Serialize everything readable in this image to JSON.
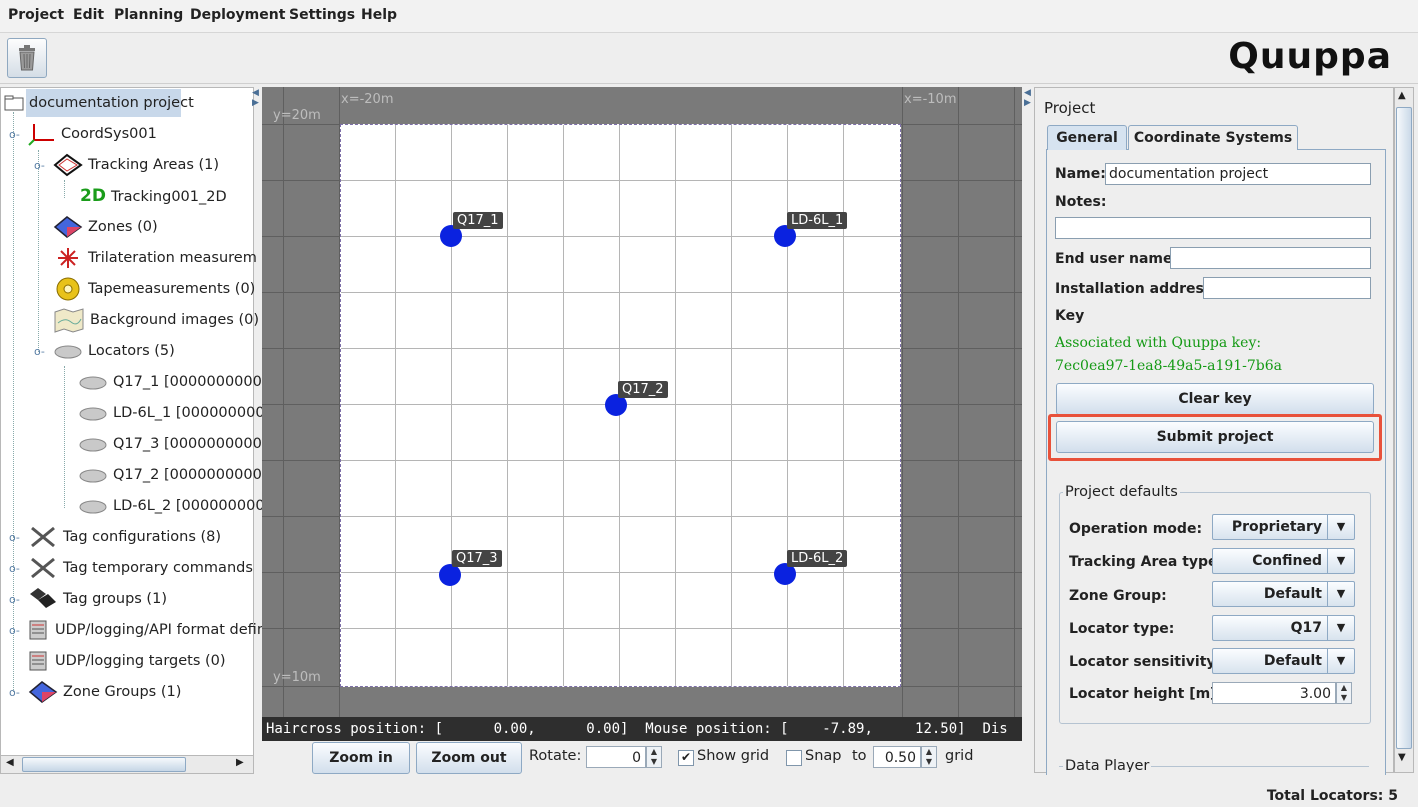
{
  "menubar": {
    "items": [
      "Project",
      "Edit",
      "Planning",
      "Deployment",
      "Settings",
      "Help"
    ]
  },
  "toolbar": {
    "trash_icon": "trash-icon",
    "logo_text": "Quuppa"
  },
  "tree": {
    "root": "documentation project",
    "coordsys": "CoordSys001",
    "tracking_areas": "Tracking Areas (1)",
    "tracking_2d_prefix": "2D",
    "tracking_item": "Tracking001_2D",
    "zones": "Zones (0)",
    "trilateration": "Trilateration measurem",
    "tapemeasurements": "Tapemeasurements (0)",
    "background_images": "Background images (0)",
    "locators": "Locators (5)",
    "locator_items": [
      "Q17_1 [000000000000",
      "LD-6L_1 [000000000",
      "Q17_3 [000000000000",
      "Q17_2 [000000000000",
      "LD-6L_2 [000000000"
    ],
    "tag_configurations": "Tag configurations (8)",
    "tag_temporary": "Tag temporary commands",
    "tag_groups": "Tag groups (1)",
    "udp_format": "UDP/logging/API format defin",
    "udp_targets": "UDP/logging targets (0)",
    "zone_groups": "Zone Groups (1)"
  },
  "canvas": {
    "x_labels": [
      "x=-20m",
      "x=-10m"
    ],
    "y_labels": [
      "y=20m",
      "y=10m"
    ],
    "locators": [
      {
        "label": "Q17_1"
      },
      {
        "label": "LD-6L_1"
      },
      {
        "label": "Q17_2"
      },
      {
        "label": "Q17_3"
      },
      {
        "label": "LD-6L_2"
      }
    ],
    "status_text": "Haircross position: [      0.00,      0.00]  Mouse position: [    -7.89,     12.50]  Dis"
  },
  "controls": {
    "zoom_in": "Zoom in",
    "zoom_out": "Zoom out",
    "rotate_label": "Rotate:",
    "rotate_value": "0",
    "show_grid_label": "Show grid",
    "show_grid_checked": true,
    "snap_label": "Snap",
    "to_label": "to",
    "snap_value": "0.50",
    "grid_label": "grid"
  },
  "project_panel": {
    "title": "Project",
    "tabs": [
      "General",
      "Coordinate Systems"
    ],
    "name_label": "Name:",
    "name_value": "documentation project",
    "notes_label": "Notes:",
    "notes_value": "",
    "end_user_label": "End user name:",
    "end_user_value": "",
    "install_label": "Installation address:",
    "install_value": "",
    "key_label": "Key",
    "key_assoc": "Associated with Quuppa key:",
    "key_value": "7ec0ea97-1ea8-49a5-a191-7b6a",
    "clear_key": "Clear key",
    "submit_project": "Submit project",
    "defaults_title": "Project defaults",
    "operation_mode_label": "Operation mode:",
    "operation_mode_value": "Proprietary",
    "tracking_area_type_label": "Tracking Area type:",
    "tracking_area_type_value": "Confined",
    "zone_group_label": "Zone Group:",
    "zone_group_value": "Default",
    "locator_type_label": "Locator type:",
    "locator_type_value": "Q17",
    "locator_sensitivity_label": "Locator sensitivity:",
    "locator_sensitivity_value": "Default",
    "locator_height_label": "Locator height  [m]:",
    "locator_height_value": "3.00",
    "data_player": "Data Player",
    "highlight_color": "#e8513a"
  },
  "footer": {
    "total_locators": "Total Locators: 5"
  }
}
